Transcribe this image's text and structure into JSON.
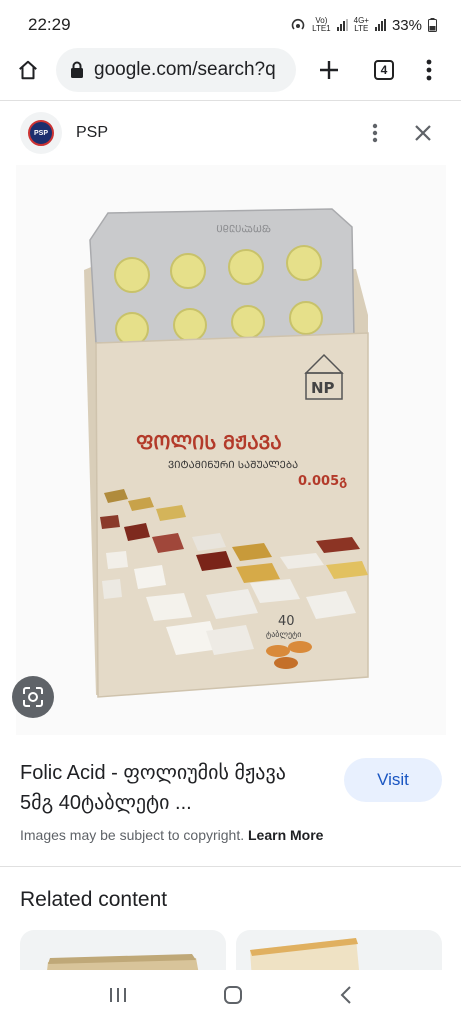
{
  "status_bar": {
    "time": "22:29",
    "volte": "Vo)\nLTE1",
    "network": "4G+\nLTE",
    "battery": "33%"
  },
  "toolbar": {
    "url": "google.com/search?q",
    "tab_count": "4"
  },
  "source": {
    "logo_text": "PSP",
    "name": "PSP"
  },
  "product_image": {
    "blister_text": "ᲤᲝᲚᲘᲣᲛᲘ",
    "brand": "NP",
    "title": "ᲤᲝᲚᲘᲡ ᲛᲟᲐᲕᲐ",
    "subtitle": "ᲕᲘᲢᲐᲛᲘᲜᲣᲠᲘ ᲡᲐᲨᲣᲐᲚᲔᲑᲐ",
    "dose": "0.005გ",
    "count": "40",
    "count_unit": "ტაბლეტი",
    "colors": {
      "box": "#e4dac8",
      "title_red": "#b33a2a",
      "pill": "#e6e08a"
    }
  },
  "result": {
    "title": "Folic Acid - ფოლიუმის მჟავა 5მგ 40ტაბლეტი ...",
    "visit_label": "Visit",
    "copyright_text": "Images may be subject to copyright.",
    "learn_more": "Learn More"
  },
  "related": {
    "heading": "Related content"
  },
  "icons": {
    "home": "home-icon",
    "lock": "lock-icon",
    "new_tab": "plus-icon",
    "menu": "more-vert-icon",
    "close": "close-icon",
    "lens": "lens-icon",
    "nav_recents": "recents-icon",
    "nav_home": "nav-home-icon",
    "nav_back": "back-icon"
  },
  "accent_color": "#1a56c2"
}
